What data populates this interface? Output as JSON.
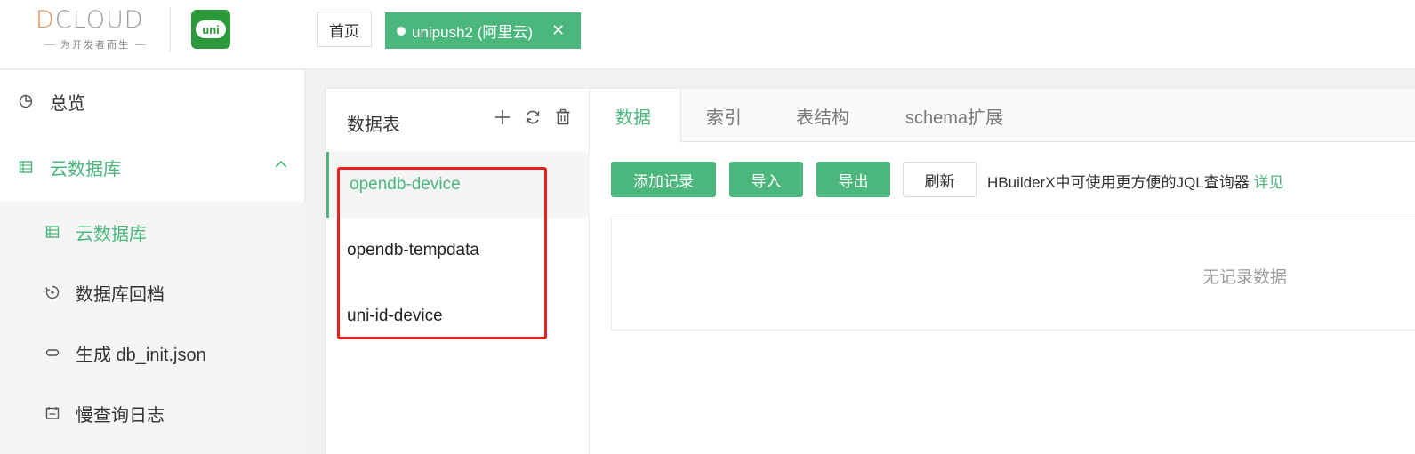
{
  "header": {
    "logo_text_prefix": "D",
    "logo_text_rest": "CLOUD",
    "logo_slogan": "为开发者而生",
    "uni_logo_text": "uni",
    "home_tab": "首页",
    "active_tab": "unipush2 (阿里云)",
    "close_glyph": "✕"
  },
  "sidebar": {
    "overview": "总览",
    "cloud_db": "云数据库",
    "sub_items": [
      "云数据库",
      "数据库回档",
      "生成 db_init.json",
      "慢查询日志"
    ]
  },
  "tables": {
    "title": "数据表",
    "items": [
      "opendb-device",
      "opendb-tempdata",
      "uni-id-device"
    ]
  },
  "content": {
    "tabs": [
      "数据",
      "索引",
      "表结构",
      "schema扩展"
    ],
    "buttons": {
      "add": "添加记录",
      "import": "导入",
      "export": "导出",
      "refresh": "刷新"
    },
    "hint_text": "HBuilderX中可使用更方便的JQL查询器",
    "hint_link": "详见",
    "empty_text": "无记录数据"
  },
  "colors": {
    "accent": "#4bb77d",
    "highlight_box": "#e8201c"
  }
}
